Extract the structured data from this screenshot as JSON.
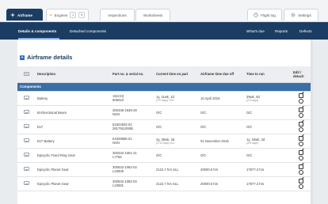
{
  "tabs": [
    {
      "label": "Airframe",
      "icon": "airframe-icon",
      "active": true
    },
    {
      "label": "Engines",
      "icon": "engines-icon",
      "badge": "1",
      "active": false
    },
    {
      "label": "Inspections",
      "active": false
    },
    {
      "label": "Worksheets",
      "active": false
    }
  ],
  "right_tabs": [
    {
      "label": "Flight log",
      "icon": "flight-log-icon"
    },
    {
      "label": "Settings",
      "icon": "gear-icon"
    }
  ],
  "subnav": {
    "left": [
      "Details & components",
      "Detached components"
    ],
    "right": [
      "What's due",
      "Reports",
      "Defects"
    ]
  },
  "section": {
    "title": "Airframe details"
  },
  "table": {
    "headers": [
      "",
      "Description",
      "Part no. & serial no.",
      "Current time on part",
      "Airframe time due off",
      "Time to run",
      "Edit / detach"
    ],
    "group_label": "Components",
    "rows": [
      {
        "description": "Battery",
        "part": "151CH)",
        "serial": "505023",
        "current": "1y, 11wk, 1d",
        "current_sub": "(797 days) TSO",
        "due": "10 April 2019",
        "ttr": "39wk, 0d",
        "ttr_sub": "(273 days)"
      },
      {
        "description": "Bi-Directional Beam",
        "part": "300436-1848-29",
        "serial": "NSN",
        "current": "O/C",
        "current_sub": "",
        "due": "O/C",
        "ttr": "O/C",
        "ttr_sub": ""
      },
      {
        "description": "ELT",
        "part": "51822502-02",
        "serial": "2817911093B",
        "current": "O/C",
        "current_sub": "",
        "due": "O/C",
        "ttr": "O/C",
        "ttr_sub": ""
      },
      {
        "description": "ELT Battery",
        "part": "51828565-01",
        "serial": "NSN",
        "current": "4y, 36wk, 3d",
        "current_sub": "(1713 days) SLL",
        "due": "01 November 2019",
        "ttr": "1y, 19wk, 3d",
        "ttr_sub": "(476 days)"
      },
      {
        "description": "Epicyclic Fixed Ring Gear",
        "part": "300432-1051-21",
        "serial": "L7755",
        "current": "O/C",
        "current_sub": "",
        "due": "O/C",
        "ttr": "O/C",
        "ttr_sub": ""
      },
      {
        "description": "Epicyclic Planet Gear",
        "part": "300632-1082-03",
        "serial": "L23508",
        "current": "2122.7 hrs SLL",
        "current_sub": "",
        "due": "20000.0 hrs",
        "ttr": "17877.3 hrs",
        "ttr_sub": ""
      },
      {
        "description": "Epicyclic Planet Gear",
        "part": "300632-1082-03",
        "serial": "L23581",
        "current": "2122.7 hrs SLL",
        "current_sub": "",
        "due": "20000.0 hrs",
        "ttr": "17877.3 hrs",
        "ttr_sub": ""
      }
    ]
  },
  "colors": {
    "nav": "#1c3d63",
    "group": "#3a6ea5",
    "accent": "#2d6db5"
  }
}
